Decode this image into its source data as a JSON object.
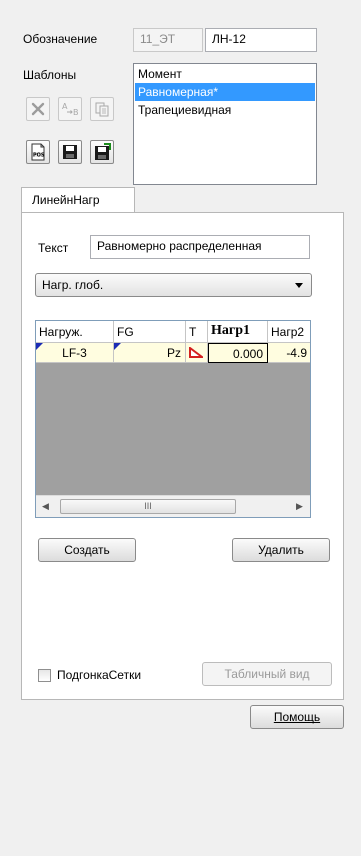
{
  "header": {
    "designation_label": "Обозначение",
    "designation_code": "11_ЭТ",
    "designation_value": "ЛН-12",
    "templates_label": "Шаблоны"
  },
  "templates": [
    {
      "label": "Момент",
      "selected": false
    },
    {
      "label": "Равномерная*",
      "selected": true
    },
    {
      "label": "Трапециевидная",
      "selected": false
    }
  ],
  "toolbar": {
    "delete_icon": "close-icon",
    "rename_icon": "rename-icon",
    "copy_icon": "copy-icon",
    "pos_icon": "pos-file-icon",
    "save_icon": "save-icon",
    "save_as_icon": "save-as-icon"
  },
  "tab": {
    "label": "ЛинейнНагр"
  },
  "form": {
    "text_label": "Текст",
    "text_value": "Равномерно распределенная",
    "load_type": "Нагр. глоб."
  },
  "grid": {
    "columns": [
      "Нагруж.",
      "FG",
      "T",
      "Нагр1",
      "Нагр2"
    ],
    "rows": [
      {
        "loading": "LF-3",
        "fg": "Pz",
        "load1": "0.000",
        "load2": "-4.9"
      }
    ],
    "scroll_thumb": "III"
  },
  "buttons": {
    "create": "Создать",
    "delete": "Удалить",
    "table_view": "Табличный вид",
    "help": "Помощь"
  },
  "options": {
    "mesh_fit_label": "ПодгонкаСетки",
    "mesh_fit_checked": false
  },
  "colors": {
    "selection": "#3399ff",
    "grid_background": "#a0a0a0",
    "cell_background": "#fffde0",
    "trapezoid_icon": "#d42020",
    "corner_marker": "#1b2bb5"
  }
}
